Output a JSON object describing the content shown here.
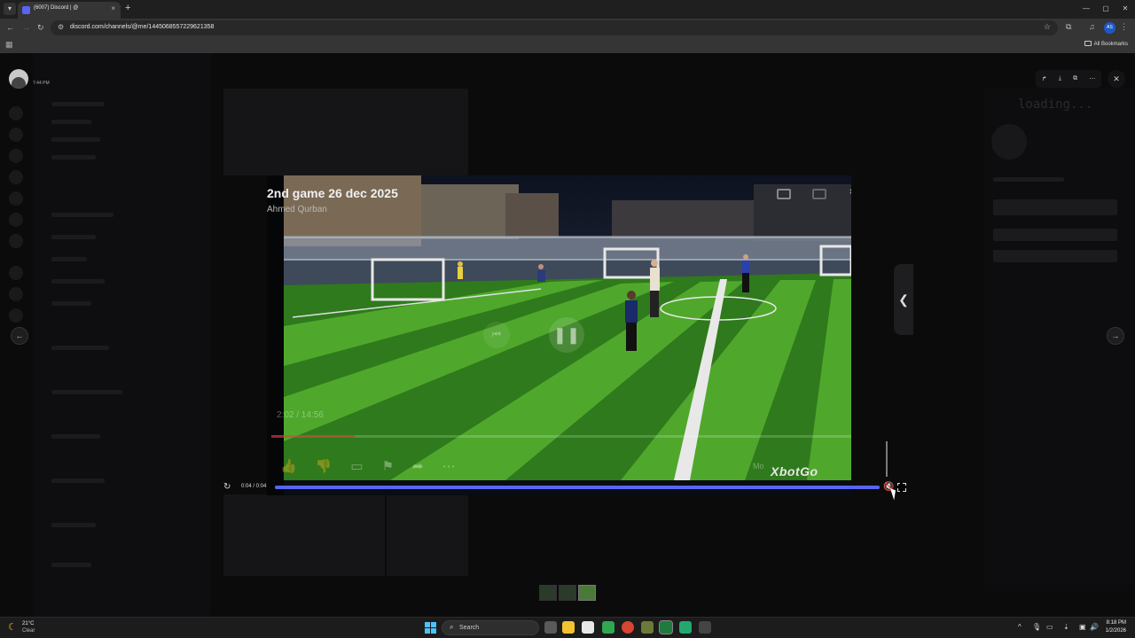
{
  "browser": {
    "tab_title": "(6007) Discord | @",
    "tab_close": "×",
    "new_tab": "+",
    "url": "discord.com/channels/@me/1445068557229621358",
    "bookmarks_label": "All Bookmarks",
    "profile_initials": "AS",
    "window_controls": [
      "—",
      "▢",
      "✕"
    ]
  },
  "page": {
    "user_time": "7:44 PM",
    "loading_text": "loading..."
  },
  "viewer": {
    "close_icon": "✕",
    "prev_arrow": "←",
    "next_arrow": "→",
    "side_tab_icon": "❮"
  },
  "video": {
    "title": "2nd game 26 dec 2025",
    "author": "Ahmed Qurban",
    "overlay_time": "2:02 / 14:56",
    "overlay_progress": 0.14,
    "more_label": "Mo",
    "watermark": "XbotGo"
  },
  "player": {
    "time": "0:04 / 0:04",
    "progress": 1.0,
    "muted": true
  },
  "thumbnails": {
    "count": 3,
    "active_index": 2
  },
  "taskbar": {
    "weather_temp": "21°C",
    "weather_desc": "Clear",
    "search_placeholder": "Search",
    "clock_time": "8:18 PM",
    "clock_date": "1/2/2026"
  }
}
